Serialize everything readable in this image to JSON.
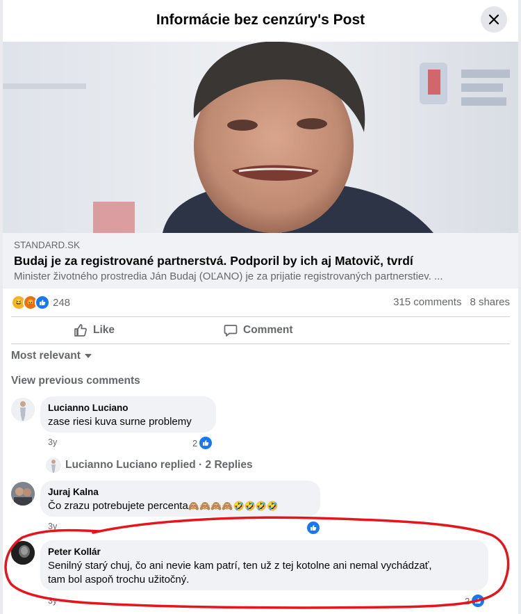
{
  "header": {
    "title": "Informácie bez cenzúry's Post"
  },
  "link": {
    "domain": "STANDARD.SK",
    "title": "Budaj je za registrované partnerstvá. Podporil by ich aj Matovič, tvrdí",
    "description": "Minister životného prostredia Ján Budaj (OĽANO) je za prijatie registrovaných partnerstiev. ..."
  },
  "stats": {
    "reaction_count": "248",
    "comments": "315 comments",
    "shares": "8 shares"
  },
  "actions": {
    "like": "Like",
    "comment": "Comment"
  },
  "sort_label": "Most relevant",
  "view_previous": "View previous comments",
  "comments": [
    {
      "name": "Lucianno Luciano",
      "text": "zase riesi kuva surne problemy",
      "time": "3y",
      "likes": "2"
    },
    {
      "name": "Juraj Kalna",
      "text": "Čo zrazu potrebujete percenta",
      "emojis": "🙈🙈🙈🙈🤣🤣🤣🤣",
      "time": "3y"
    },
    {
      "name": "Peter Kollár",
      "text_line1": "Senilný starý chuj, čo ani nevie kam patrí, ten už z tej kotolne ani nemal vychádzať,",
      "text_line2": "tam bol aspoň trochu užitočný.",
      "time": "3y",
      "likes": "2"
    }
  ],
  "replies_label": "Lucianno Luciano replied · 2 Replies",
  "colors": {
    "accent": "#1877f2",
    "annotation": "#e8141b",
    "bubble": "#f0f2f5"
  }
}
